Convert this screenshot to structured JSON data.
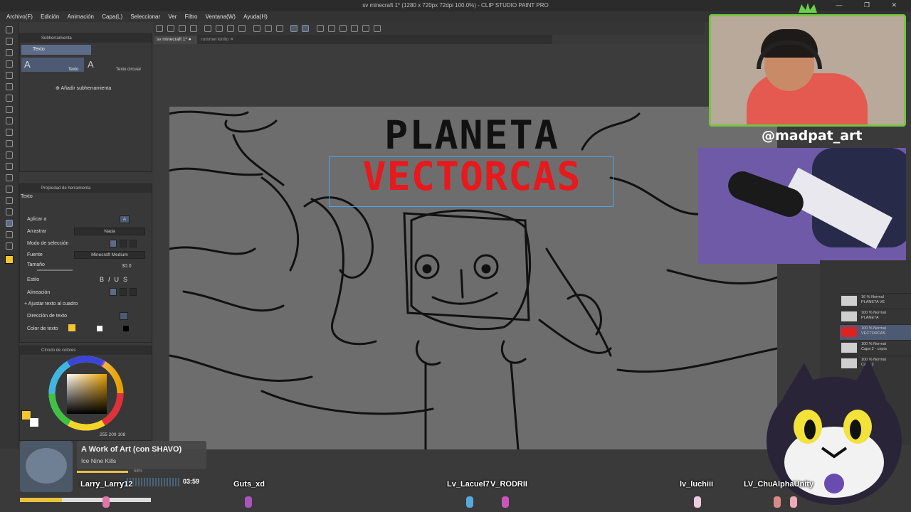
{
  "window": {
    "title": "sv minecraft 1* (1280 x 720px 72dpi 100.0%) - CLIP STUDIO PAINT PRO"
  },
  "menu": [
    "Archivo(F)",
    "Edición",
    "Animación",
    "Capa(L)",
    "Seleccionar",
    "Ver",
    "Filtro",
    "Ventana(W)",
    "Ayuda(H)"
  ],
  "tabs": [
    {
      "label": "sv minecraft 1*",
      "active": true
    },
    {
      "label": "rommel kinito",
      "active": false
    }
  ],
  "subtool": {
    "panel_title": "Subherramienta",
    "group": "Texto",
    "items": [
      "Texto",
      "Texto circular"
    ],
    "add_label": "Añadir subherramienta"
  },
  "toolprop": {
    "panel_title": "Propiedad de herramienta",
    "tool_name": "Texto",
    "rows": {
      "apply": "Aplicar a",
      "drag": "Arrastrar",
      "drag_value": "Nada",
      "select_mode": "Modo de selección",
      "font": "Fuente",
      "font_value": "Minecraft Medium",
      "size": "Tamaño",
      "size_value": "30.0",
      "style": "Estilo",
      "align": "Alineación",
      "fit": "Ajustar texto al cuadro",
      "direction": "Dirección de texto",
      "color": "Color de texto"
    }
  },
  "color_panel": {
    "title": "Círculo de colores",
    "main_color": "#f5c431",
    "r": "255",
    "g": "209",
    "b": "108"
  },
  "canvas": {
    "title_line1": "PLANETA",
    "title_line2": "VECTORCAS",
    "title_line1_color": "#111111",
    "title_line2_color": "#e8181c"
  },
  "stream": {
    "handle": "@madpat_art",
    "song": "A Work of Art (con SHAVO)",
    "artist": "Ice Nine Kills",
    "song_percent": "58%",
    "progress": 0.32,
    "time": "03:59"
  },
  "layers": [
    {
      "blend": "16 % Normal",
      "name": "PLANETA VE"
    },
    {
      "blend": "100 % Normal",
      "name": "PLANETA"
    },
    {
      "blend": "100 % Normal",
      "name": "VECTORCAS"
    },
    {
      "blend": "100 % Normal",
      "name": "Capa 2 - copia"
    },
    {
      "blend": "100 % Normal",
      "name": "Capa 2"
    }
  ],
  "chatters": [
    "Larry_Larry12",
    "Guts_xd",
    "Lv_Lacuel7",
    "V_RODRII",
    "lv_luchiii",
    "LV_Chu",
    "AlphaUnity"
  ]
}
